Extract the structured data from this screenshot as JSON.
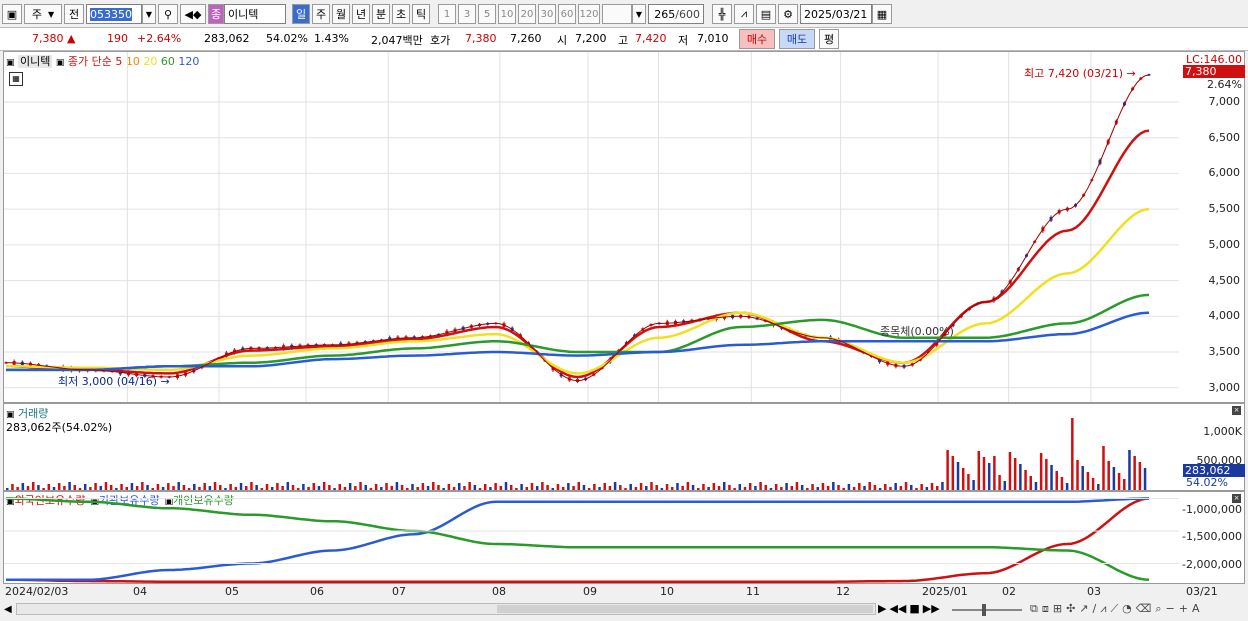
{
  "toolbar": {
    "type_label": "주",
    "prev_label": "전",
    "code": "053350",
    "category": "종",
    "name": "이니텍",
    "periods": [
      "일",
      "주",
      "월",
      "년",
      "분",
      "초",
      "틱"
    ],
    "active_period": "일",
    "intervals": [
      "1",
      "3",
      "5",
      "10",
      "20",
      "30",
      "60",
      "120"
    ],
    "count": "265",
    "count_max": "/600",
    "date": "2025/03/21"
  },
  "quote": {
    "price": "7,380",
    "change": "190",
    "change_pct": "+2.64%",
    "volume": "283,062",
    "volume_ratio": "54.02%",
    "turnover": "1.43%",
    "amount": "2,047백만",
    "hoga_label": "호가",
    "ask": "7,380",
    "bid": "7,260",
    "open_label": "시",
    "open": "7,200",
    "high_label": "고",
    "high": "7,420",
    "low_label": "저",
    "low": "7,010",
    "buy_label": "매수",
    "sell_label": "매도",
    "eval_label": "평"
  },
  "price_panel": {
    "stock_label": "이니텍",
    "ma_label": "종가 단순",
    "ma_periods": [
      "5",
      "10",
      "20",
      "60",
      "120"
    ],
    "ma_colors": [
      "#d01010",
      "#f08a00",
      "#f0e020",
      "#2a9a2a",
      "#2a5bd7"
    ],
    "lc_label": "LC:146.00",
    "last_price_tag": "7,380",
    "last_pct_tag": "2.64%",
    "high_annotation": "최고 7,420 (03/21)",
    "low_annotation": "최저 3,000 (04/16)",
    "mid_annotation": "종목체(0.00%)",
    "y_ticks": [
      "7,000",
      "6,500",
      "6,000",
      "5,500",
      "5,000",
      "4,500",
      "4,000",
      "3,500",
      "3,000"
    ]
  },
  "volume_panel": {
    "title": "거래량",
    "value": "283,062주(54.02%)",
    "y_ticks": [
      "1,000K",
      "500,000"
    ],
    "last_tag": "283,062",
    "pct_tag": "54.02%"
  },
  "holding_panel": {
    "legend": [
      "외국인보유수량",
      "기관보유수량",
      "개인보유수량"
    ],
    "colors": [
      "#d01010",
      "#2a5bd7",
      "#2a9a2a"
    ],
    "y_ticks": [
      "-1,000,000",
      "-1,500,000",
      "-2,000,000"
    ]
  },
  "x_axis": {
    "labels": [
      "2024/02/03",
      "04",
      "05",
      "06",
      "07",
      "08",
      "09",
      "10",
      "11",
      "12",
      "2025/01",
      "02",
      "03",
      "03/21"
    ]
  },
  "chart_data": {
    "type": "line",
    "title": "",
    "x": [
      "2024-02",
      "2024-03",
      "2024-04",
      "2024-05",
      "2024-06",
      "2024-07",
      "2024-08",
      "2024-09",
      "2024-10",
      "2024-11",
      "2024-12",
      "2025-01",
      "2025-02",
      "2025-03-10",
      "2025-03-21"
    ],
    "series": [
      {
        "name": "종가",
        "values": [
          3350,
          3250,
          3150,
          3550,
          3600,
          3700,
          3900,
          3100,
          3900,
          4000,
          3700,
          3300,
          4200,
          5500,
          7380
        ]
      },
      {
        "name": "5",
        "values": [
          3300,
          3250,
          3200,
          3520,
          3580,
          3680,
          3850,
          3150,
          3850,
          4050,
          3650,
          3350,
          4200,
          5200,
          6600
        ]
      },
      {
        "name": "20",
        "values": [
          3300,
          3280,
          3250,
          3450,
          3550,
          3650,
          3750,
          3200,
          3700,
          4050,
          3700,
          3350,
          3900,
          4600,
          5500
        ]
      },
      {
        "name": "60",
        "values": [
          3250,
          3250,
          3300,
          3350,
          3450,
          3550,
          3650,
          3500,
          3500,
          3850,
          3950,
          3700,
          3700,
          3900,
          4300
        ]
      },
      {
        "name": "120",
        "values": [
          3250,
          3250,
          3300,
          3300,
          3400,
          3450,
          3500,
          3450,
          3500,
          3600,
          3650,
          3650,
          3650,
          3750,
          4050
        ]
      }
    ],
    "ylim": [
      2800,
      7700
    ],
    "volume": {
      "type": "bar",
      "max_label": "1,000K",
      "peak": 1250000
    },
    "holdings": {
      "type": "line",
      "ylim": [
        -2300000,
        -900000
      ],
      "series": [
        {
          "name": "외국인보유수량",
          "values": [
            -2250000,
            -2270000,
            -2280000,
            -2280000,
            -2280000,
            -2280000,
            -2280000,
            -2280000,
            -2280000,
            -2280000,
            -2280000,
            -2270000,
            -2150000,
            -1700000,
            -1000000
          ]
        },
        {
          "name": "기관보유수량",
          "values": [
            -2250000,
            -2250000,
            -2100000,
            -2000000,
            -1800000,
            -1550000,
            -1050000,
            -1050000,
            -1050000,
            -1050000,
            -1050000,
            -1050000,
            -1050000,
            -1050000,
            -1000000
          ]
        },
        {
          "name": "개인보유수량",
          "values": [
            -1000000,
            -1050000,
            -1150000,
            -1250000,
            -1350000,
            -1500000,
            -1700000,
            -1750000,
            -1750000,
            -1750000,
            -1750000,
            -1750000,
            -1750000,
            -1800000,
            -2250000
          ]
        }
      ]
    }
  }
}
